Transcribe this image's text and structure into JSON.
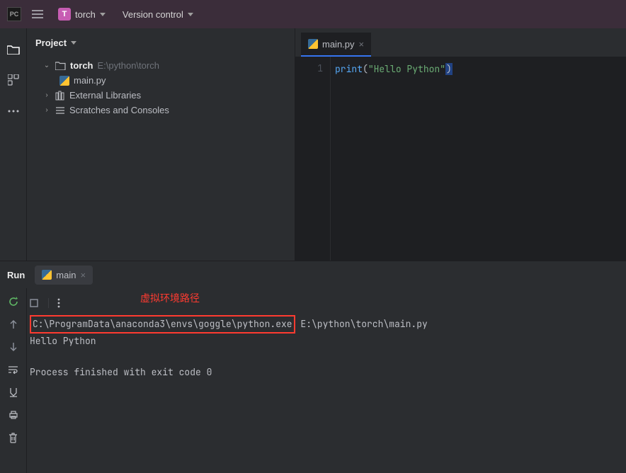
{
  "titlebar": {
    "project_badge": "T",
    "project_name": "torch",
    "vcs_label": "Version control"
  },
  "project_panel": {
    "title": "Project",
    "root": {
      "name": "torch",
      "path": "E:\\python\\torch",
      "expanded": true
    },
    "root_children": [
      {
        "icon": "python",
        "name": "main.py"
      }
    ],
    "external": "External Libraries",
    "scratches": "Scratches and Consoles"
  },
  "editor": {
    "tab_label": "main.py",
    "line_no_1": "1",
    "code_line_1": {
      "fn": "print",
      "open": "(",
      "str": "\"Hello Python\"",
      "close": ")"
    }
  },
  "run": {
    "panel_label": "Run",
    "tab_label": "main",
    "annotation": "虚拟环境路径",
    "interp_path": "C:\\ProgramData\\anaconda3\\envs\\goggle\\python.exe",
    "script_path": " E:\\python\\torch\\main.py",
    "output_line": "Hello Python",
    "exit_line": "Process finished with exit code 0"
  }
}
